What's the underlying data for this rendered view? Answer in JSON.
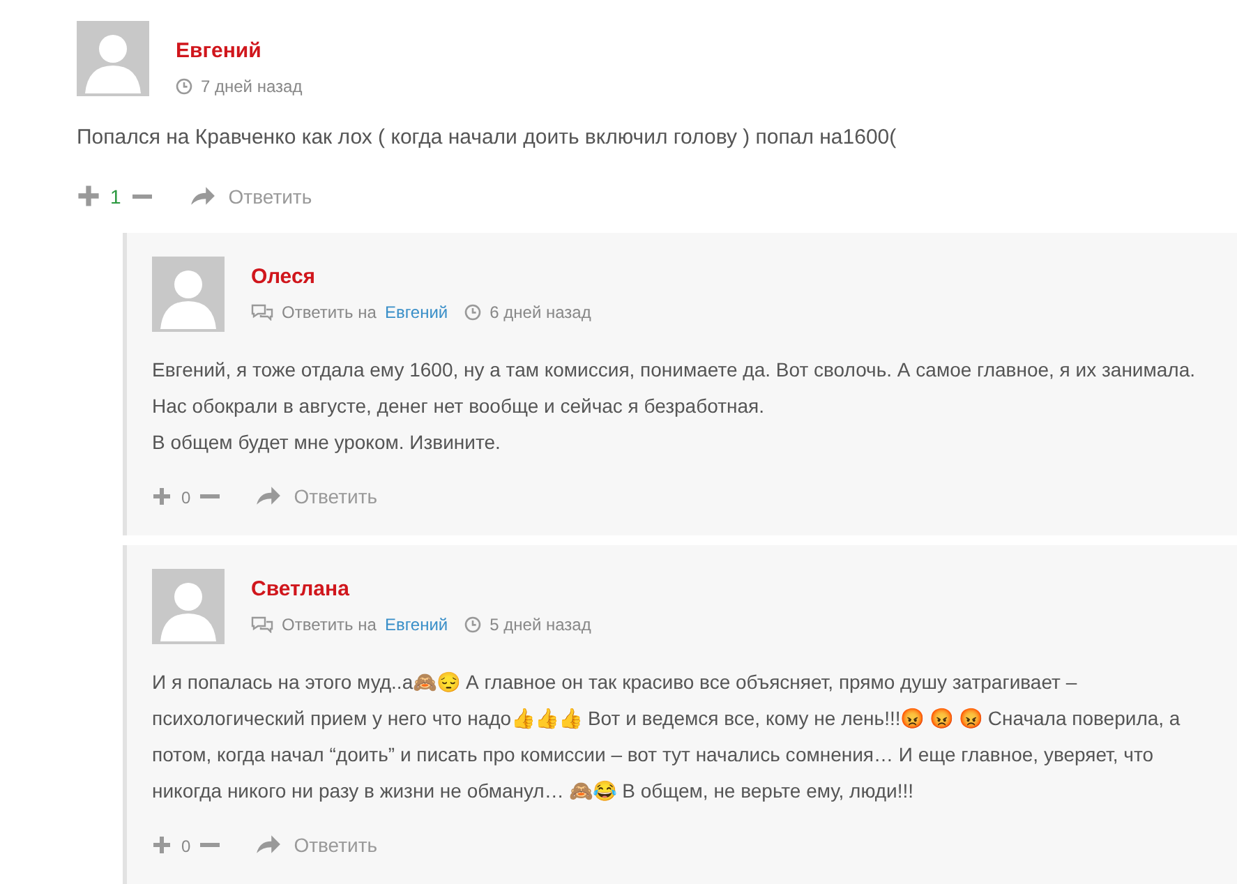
{
  "comment": {
    "author": "Евгений",
    "time": "7 дней назад",
    "text": "Попался на Кравченко как лох ( когда начали доить включил голову ) попал на1600(",
    "votes": "1",
    "reply": "Ответить"
  },
  "replies": [
    {
      "author": "Олеся",
      "reply_to_label": "Ответить на",
      "reply_to": "Евгений",
      "time": "6 дней назад",
      "paragraphs": [
        "Евгений, я тоже отдала ему 1600, ну а там комиссия, понимаете да. Вот сволочь. А самое главное, я их занимала. Нас обокрали в августе, денег нет вообще и сейчас я безработная.",
        "В общем будет мне уроком. Извините."
      ],
      "votes": "0",
      "reply": "Ответить"
    },
    {
      "author": "Светлана",
      "reply_to_label": "Ответить на",
      "reply_to": "Евгений",
      "time": "5 дней назад",
      "paragraphs": [
        "И я попалась на этого муд..а🙈😔 А главное он так красиво все объясняет, прямо душу затрагивает – психологический прием у него что надо👍👍👍 Вот и ведемся все, кому не лень!!!😡 😡 😡 Сначала поверила, а потом, когда начал “доить” и писать про комиссии – вот тут начались сомнения… И еще главное, уверяет, что никогда никого ни разу в жизни не обманул… 🙈😂 В общем, не верьте ему, люди!!!"
      ],
      "votes": "0",
      "reply": "Ответить"
    }
  ]
}
